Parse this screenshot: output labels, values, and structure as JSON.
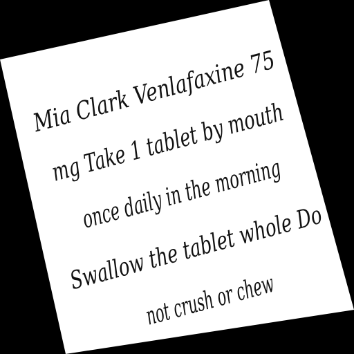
{
  "note": {
    "lines": [
      "Mia Clark Venlafaxine 75",
      "mg Take 1 tablet by mouth",
      "once daily in the morning",
      "Swallow the tablet whole Do",
      "not crush or chew"
    ]
  },
  "colors": {
    "background": "#000000",
    "paper": "#ffffff",
    "ink": "#111111"
  }
}
